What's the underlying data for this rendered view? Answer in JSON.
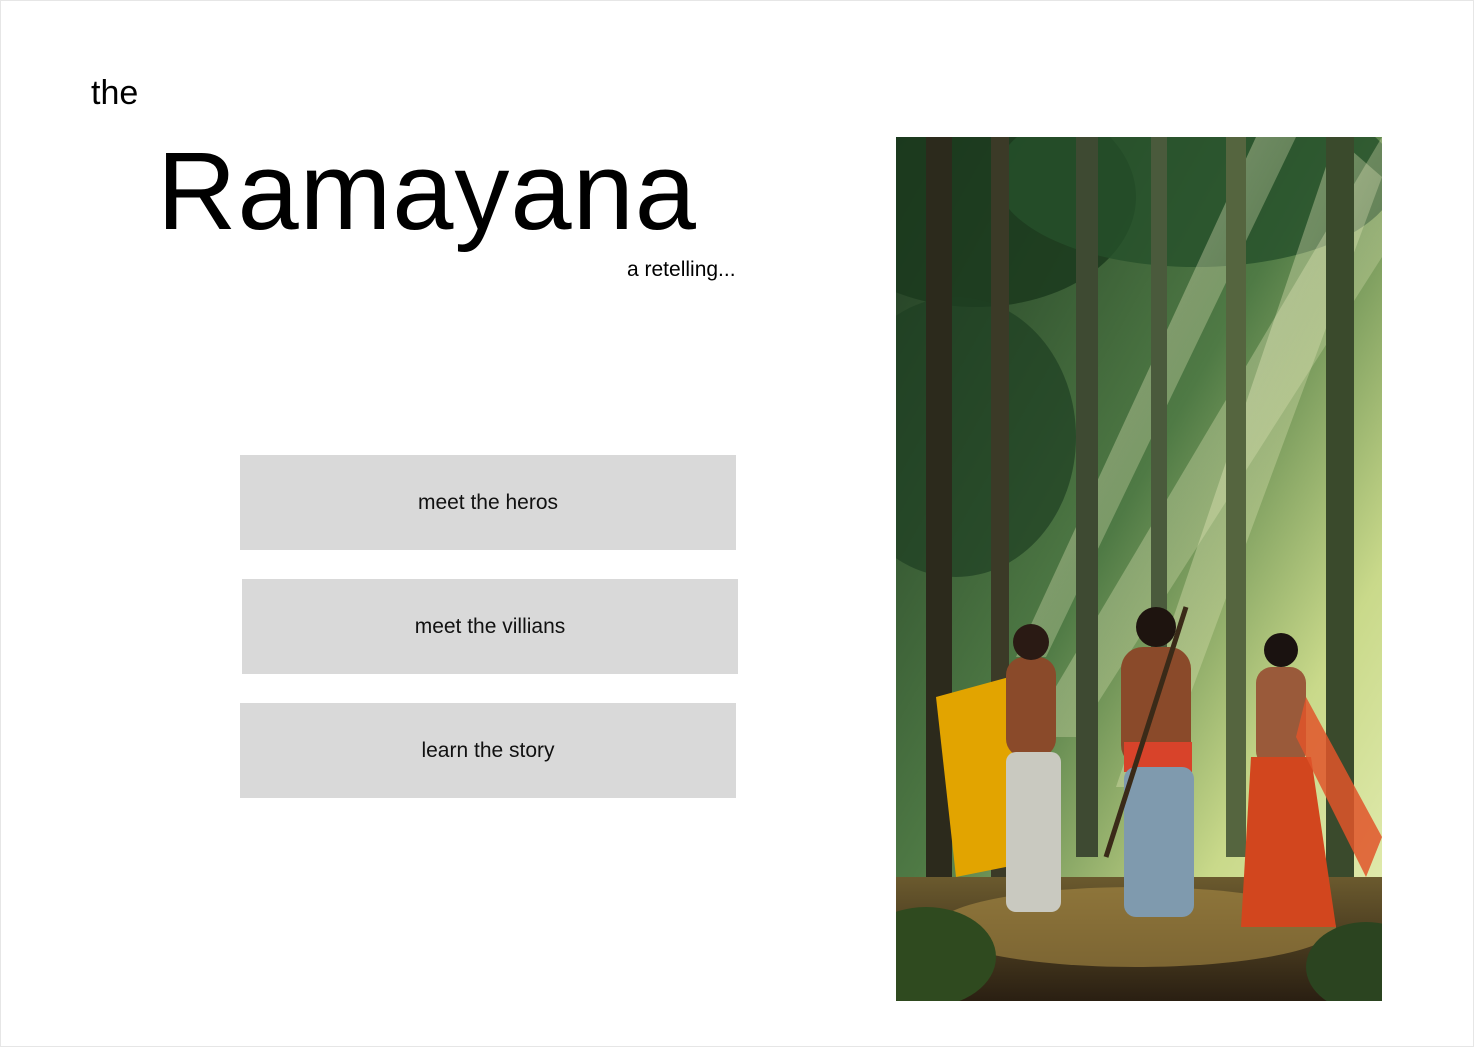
{
  "header": {
    "prefix": "the",
    "title": "Ramayana",
    "subtitle": "a retelling..."
  },
  "nav": {
    "buttons": [
      {
        "label": "meet the heros"
      },
      {
        "label": "meet the villians"
      },
      {
        "label": "learn the story"
      }
    ]
  },
  "colors": {
    "button_bg": "#d9d9d9",
    "text": "#000000",
    "background": "#ffffff"
  }
}
